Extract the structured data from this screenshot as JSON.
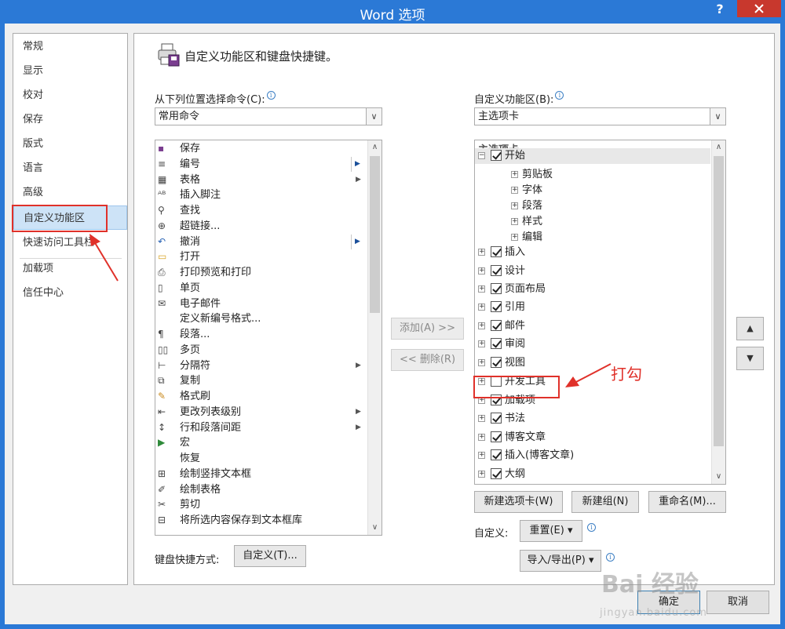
{
  "window": {
    "title": "Word 选项",
    "help": "?"
  },
  "nav": {
    "items": [
      {
        "label": "常规"
      },
      {
        "label": "显示"
      },
      {
        "label": "校对"
      },
      {
        "label": "保存"
      },
      {
        "label": "版式"
      },
      {
        "label": "语言"
      },
      {
        "label": "高级"
      },
      {
        "label": "自定义功能区",
        "active": true
      },
      {
        "label": "快速访问工具栏"
      },
      {
        "label": "加载项"
      },
      {
        "label": "信任中心"
      }
    ]
  },
  "main": {
    "title": "自定义功能区和键盘快捷键。",
    "choose_label": "从下列位置选择命令(C):",
    "choose_value": "常用命令",
    "customize_label": "自定义功能区(B):",
    "customize_value": "主选项卡",
    "commands": [
      {
        "label": "保存",
        "icon": "save-icon"
      },
      {
        "label": "编号",
        "icon": "numbering-icon",
        "sub": "box"
      },
      {
        "label": "表格",
        "icon": "table-icon",
        "sub": "arrow"
      },
      {
        "label": "插入脚注",
        "icon": "footnote-icon"
      },
      {
        "label": "查找",
        "icon": "find-icon"
      },
      {
        "label": "超链接...",
        "icon": "hyperlink-icon"
      },
      {
        "label": "撤消",
        "icon": "undo-icon",
        "sub": "box"
      },
      {
        "label": "打开",
        "icon": "open-folder-icon"
      },
      {
        "label": "打印预览和打印",
        "icon": "print-preview-icon"
      },
      {
        "label": "单页",
        "icon": "single-page-icon"
      },
      {
        "label": "电子邮件",
        "icon": "email-icon"
      },
      {
        "label": "定义新编号格式...",
        "icon": "none"
      },
      {
        "label": "段落...",
        "icon": "paragraph-icon"
      },
      {
        "label": "多页",
        "icon": "multi-page-icon"
      },
      {
        "label": "分隔符",
        "icon": "breaks-icon",
        "sub": "arrow"
      },
      {
        "label": "复制",
        "icon": "copy-icon"
      },
      {
        "label": "格式刷",
        "icon": "format-painter-icon"
      },
      {
        "label": "更改列表级别",
        "icon": "list-level-icon",
        "sub": "arrow"
      },
      {
        "label": "行和段落间距",
        "icon": "line-spacing-icon",
        "sub": "arrow"
      },
      {
        "label": "宏",
        "icon": "macro-icon"
      },
      {
        "label": "恢复",
        "icon": "none"
      },
      {
        "label": "绘制竖排文本框",
        "icon": "vertical-textbox-icon"
      },
      {
        "label": "绘制表格",
        "icon": "draw-table-icon"
      },
      {
        "label": "剪切",
        "icon": "cut-icon"
      },
      {
        "label": "将所选内容保存到文本框库",
        "icon": "save-to-gallery-icon"
      }
    ],
    "add_button": "添加(A) >>",
    "remove_button": "<< 删除(R)",
    "tree_header": "主选项卡",
    "tree": [
      {
        "label": "开始",
        "level": 0,
        "exp": "−",
        "checked": true
      },
      {
        "label": "剪贴板",
        "level": 1,
        "exp": "+"
      },
      {
        "label": "字体",
        "level": 1,
        "exp": "+"
      },
      {
        "label": "段落",
        "level": 1,
        "exp": "+"
      },
      {
        "label": "样式",
        "level": 1,
        "exp": "+"
      },
      {
        "label": "编辑",
        "level": 1,
        "exp": "+"
      },
      {
        "label": "插入",
        "level": 0,
        "exp": "+",
        "checked": true
      },
      {
        "label": "设计",
        "level": 0,
        "exp": "+",
        "checked": true
      },
      {
        "label": "页面布局",
        "level": 0,
        "exp": "+",
        "checked": true
      },
      {
        "label": "引用",
        "level": 0,
        "exp": "+",
        "checked": true
      },
      {
        "label": "邮件",
        "level": 0,
        "exp": "+",
        "checked": true
      },
      {
        "label": "审阅",
        "level": 0,
        "exp": "+",
        "checked": true
      },
      {
        "label": "视图",
        "level": 0,
        "exp": "+",
        "checked": true
      },
      {
        "label": "开发工具",
        "level": 0,
        "exp": "+",
        "checked": false
      },
      {
        "label": "加载项",
        "level": 0,
        "exp": "+",
        "checked": true
      },
      {
        "label": "书法",
        "level": 0,
        "exp": "+",
        "checked": true
      },
      {
        "label": "博客文章",
        "level": 0,
        "exp": "+",
        "checked": true
      },
      {
        "label": "插入(博客文章)",
        "level": 0,
        "exp": "+",
        "checked": true
      },
      {
        "label": "大纲",
        "level": 0,
        "exp": "+",
        "checked": true
      }
    ],
    "new_tab_button": "新建选项卡(W)",
    "new_group_button": "新建组(N)",
    "rename_button": "重命名(M)...",
    "custom_label": "自定义:",
    "reset_button": "重置(E) ▾",
    "import_export_button": "导入/导出(P) ▾",
    "keyboard_label": "键盘快捷方式:",
    "keyboard_button": "自定义(T)...",
    "move_up": "▲",
    "move_down": "▼"
  },
  "annotation": {
    "text": "打勾"
  },
  "footer": {
    "ok": "确定",
    "cancel": "取消"
  },
  "watermark": {
    "logo": "Bai 经验",
    "url": "jingyan.baidu.com"
  },
  "colors": {
    "titlebar": "#2b79d6",
    "close": "#c8382d",
    "annotation": "#e0312a",
    "selected": "#cde3f7"
  }
}
